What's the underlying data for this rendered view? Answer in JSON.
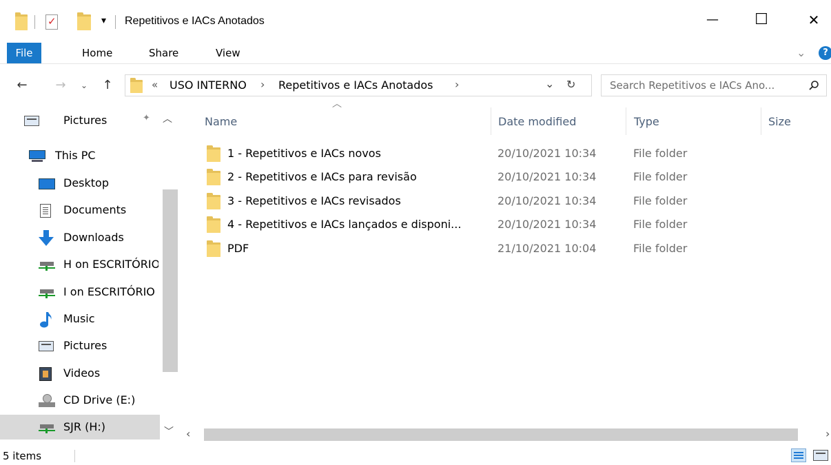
{
  "window": {
    "title": "Repetitivos e IACs Anotados",
    "qat_dropdown": "▾",
    "minimize": "—",
    "maximize": "☐",
    "close": "✕"
  },
  "ribbon": {
    "tabs": [
      "File",
      "Home",
      "Share",
      "View"
    ],
    "expand": "⌄",
    "help": "?"
  },
  "address": {
    "overflow": "«",
    "crumbs": [
      "USO INTERNO",
      "Repetitivos e IACs Anotados"
    ],
    "separator": "›",
    "dropdown": "⌄",
    "refresh": "↻"
  },
  "search": {
    "placeholder": "Search Repetitivos e IACs Ano..."
  },
  "navpane": {
    "items": [
      {
        "label": "Pictures",
        "icon": "pictures-icon",
        "pinned": true
      },
      {
        "label": "This PC",
        "icon": "this-pc-icon"
      },
      {
        "label": "Desktop",
        "icon": "desktop-icon"
      },
      {
        "label": "Documents",
        "icon": "documents-icon"
      },
      {
        "label": "Downloads",
        "icon": "downloads-icon"
      },
      {
        "label": "H on ESCRITÓRIO",
        "icon": "network-drive-icon"
      },
      {
        "label": "I on ESCRITÓRIO",
        "icon": "network-drive-icon"
      },
      {
        "label": "Music",
        "icon": "music-icon"
      },
      {
        "label": "Pictures",
        "icon": "pictures-icon"
      },
      {
        "label": "Videos",
        "icon": "videos-icon"
      },
      {
        "label": "CD Drive (E:)",
        "icon": "cd-drive-icon"
      },
      {
        "label": "SJR (H:)",
        "icon": "network-drive-icon",
        "selected": true
      }
    ]
  },
  "filelist": {
    "columns": {
      "name": "Name",
      "date": "Date modified",
      "type": "Type",
      "size": "Size"
    },
    "rows": [
      {
        "name": "1 - Repetitivos e IACs novos",
        "date": "20/10/2021 10:34",
        "type": "File folder"
      },
      {
        "name": "2 - Repetitivos e IACs para revisão",
        "date": "20/10/2021 10:34",
        "type": "File folder"
      },
      {
        "name": "3 - Repetitivos e IACs revisados",
        "date": "20/10/2021 10:34",
        "type": "File folder"
      },
      {
        "name": "4 - Repetitivos e IACs lançados e disponi...",
        "date": "20/10/2021 10:34",
        "type": "File folder"
      },
      {
        "name": "PDF",
        "date": "21/10/2021 10:04",
        "type": "File folder"
      }
    ]
  },
  "status": {
    "items_count": "5 items"
  },
  "colors": {
    "accent": "#1979ca",
    "folder": "#f8d775",
    "header_text": "#4c607a",
    "selection": "#d9d9d9"
  }
}
